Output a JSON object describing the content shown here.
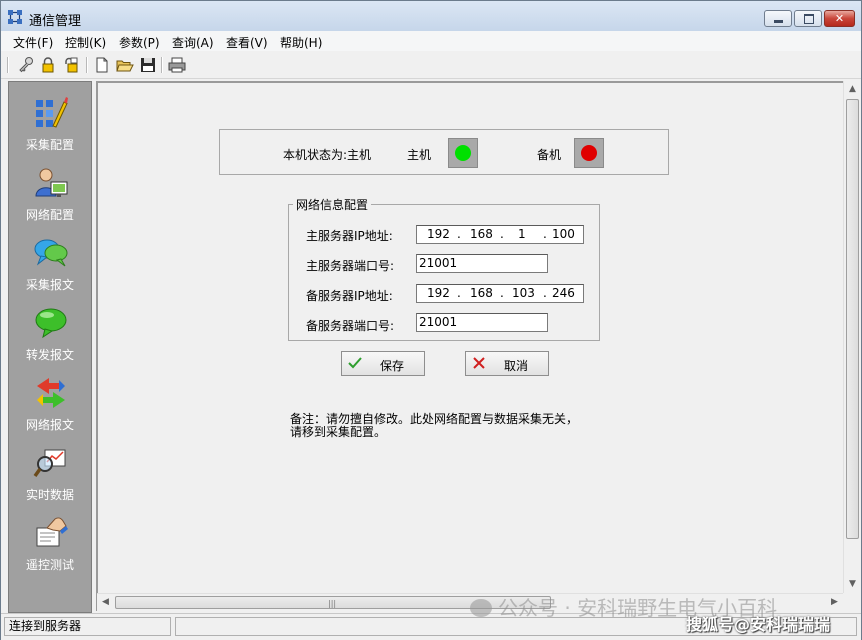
{
  "window": {
    "title": "通信管理",
    "controls": {
      "minimize_icon": "minimize-icon",
      "maximize_icon": "maximize-icon",
      "close_icon": "close-icon"
    }
  },
  "menu": [
    {
      "label": "文件(F)"
    },
    {
      "label": "控制(K)"
    },
    {
      "label": "参数(P)"
    },
    {
      "label": "查询(A)"
    },
    {
      "label": "查看(V)"
    },
    {
      "label": "帮助(H)"
    }
  ],
  "toolbar": {
    "icons": [
      "key-icon",
      "lock-icon",
      "unlock-icon",
      "new-file-icon",
      "open-folder-icon",
      "save-icon",
      "print-icon"
    ]
  },
  "sidebar": {
    "items": [
      {
        "label": "采集配置",
        "icon": "config-tools-icon"
      },
      {
        "label": "网络配置",
        "icon": "network-user-icon"
      },
      {
        "label": "采集报文",
        "icon": "chat-bubbles-icon"
      },
      {
        "label": "转发报文",
        "icon": "green-bubble-icon"
      },
      {
        "label": "网络报文",
        "icon": "exchange-arrows-icon"
      },
      {
        "label": "实时数据",
        "icon": "magnifier-chart-icon"
      },
      {
        "label": "遥控测试",
        "icon": "hand-document-icon"
      }
    ]
  },
  "status_panel": {
    "state_label": "本机状态为:主机",
    "primary_label": "主机",
    "primary_color": "#00e000",
    "backup_label": "备机",
    "backup_color": "#e00000"
  },
  "network_config": {
    "legend": "网络信息配置",
    "primary_ip_label": "主服务器IP地址:",
    "primary_ip": [
      "192",
      "168",
      "1",
      "100"
    ],
    "primary_port_label": "主服务器端口号:",
    "primary_port": "21001",
    "backup_ip_label": "备服务器IP地址:",
    "backup_ip": [
      "192",
      "168",
      "103",
      "246"
    ],
    "backup_port_label": "备服务器端口号:",
    "backup_port": "21001"
  },
  "buttons": {
    "save_label": "保存",
    "cancel_label": "取消"
  },
  "note": {
    "line1": "备注：请勿擅自修改。此处网络配置与数据采集无关，",
    "line2": "请移到采集配置。"
  },
  "statusbar": {
    "text": "连接到服务器"
  },
  "watermarks": {
    "wechat": "公众号 · 安科瑞野生电气小百科",
    "sohu": "搜狐号@安科瑞瑞瑞"
  }
}
